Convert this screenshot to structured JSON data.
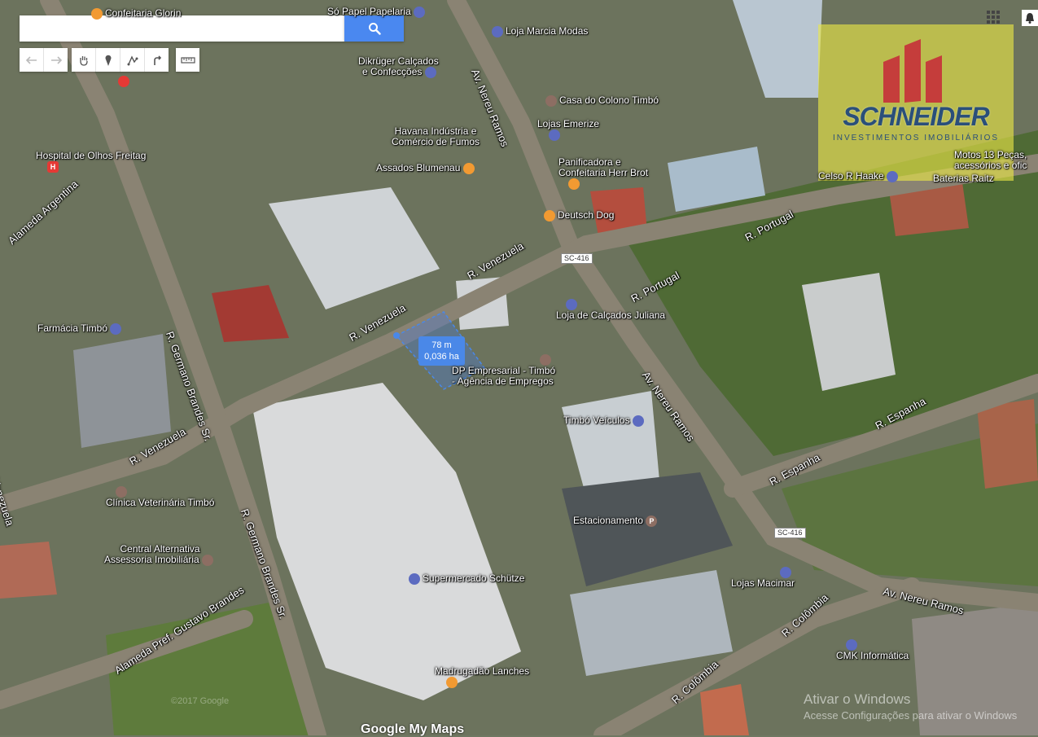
{
  "search": {
    "placeholder": "",
    "value": ""
  },
  "toolbar": {
    "undo": "undo-icon",
    "redo": "redo-icon",
    "tools": [
      "hand-icon",
      "marker-icon",
      "draw-line-icon",
      "directions-icon",
      "ruler-icon"
    ]
  },
  "measure": {
    "distance": "78 m",
    "area": "0,036 ha"
  },
  "logo": {
    "name": "SCHNEIDER",
    "tagline": "INVESTIMENTOS IMOBILIÁRIOS"
  },
  "places": {
    "so_papel": "Só Papel Papelaria",
    "marcia": "Loja Marcia Modas",
    "dikruger1": "Dikrüger Calçados",
    "dikruger2": "e Confecções",
    "casa_colono": "Casa do Colono Timbó",
    "lojas_emerize": "Lojas Emerize",
    "havana1": "Havana Indústria e",
    "havana2": "Comércio de Fumos",
    "panificadora1": "Panificadora e",
    "panificadora2": "Confeitaria Herr Brot",
    "assados": "Assados Blumenau",
    "deutsch": "Deutsch Dog",
    "hospital": "Hospital de Olhos Freitag",
    "farmacia": "Farmácia Timbó",
    "loja_calcados": "Loja de Calçados Juliana",
    "dp1": "DP Empresarial - Timbó",
    "dp2": "- Agência de Empregos",
    "timbo_veiculos": "Timbó Veículos",
    "clinica": "Clínica Veterinária Timbó",
    "central1": "Central Alternativa",
    "central2": "Assessoria Imobiliária",
    "estacionamento": "Estacionamento",
    "supermercado": "Supermercado Schütze",
    "lojas_macimar": "Lojas Macimar",
    "cmk": "CMK Informática",
    "madrugadao": "Madrugadão Lanches",
    "celso": "Celso R Haake",
    "baterias": "Baterias Raitz",
    "motos1": "Motos 13 Peças,",
    "motos2": "acessórios e ofic",
    "confeitaria_top": "Confeitaria Glorin"
  },
  "roads": {
    "nereu_top": "Av. Nereu Ramos",
    "nereu_mid": "Av. Nereu Ramos",
    "nereu_bottom": "Av. Nereu Ramos",
    "venezuela1": "R. Venezuela",
    "venezuela2": "R. Venezuela",
    "venezuela3": "R. Venezuela",
    "venezuela4": "Venezuela",
    "germano1": "R. Germano Brandes Sr.",
    "germano2": "R. Germano Brandes Sr.",
    "alameda_arg": "Alameda Argentina",
    "alameda_pref": "Alameda Pref. Gustavo Brandes",
    "portugal1": "R. Portugal",
    "portugal2": "R. Portugal",
    "espanha1": "R. Espanha",
    "espanha2": "R. Espanha",
    "colombia1": "R. Colômbia",
    "colombia2": "R. Colômbia",
    "sc416a": "SC-416",
    "sc416b": "SC-416"
  },
  "footer": {
    "activate_title": "Ativar o Windows",
    "activate_sub": "Acesse Configurações para ativar o Windows",
    "google": "Google My Maps",
    "copyright": "©2017 Google"
  },
  "colors": {
    "accent": "#4a88f0",
    "logo_yellow": "#ece946",
    "logo_red": "#c62f3a",
    "logo_blue": "#2a4f7a"
  }
}
